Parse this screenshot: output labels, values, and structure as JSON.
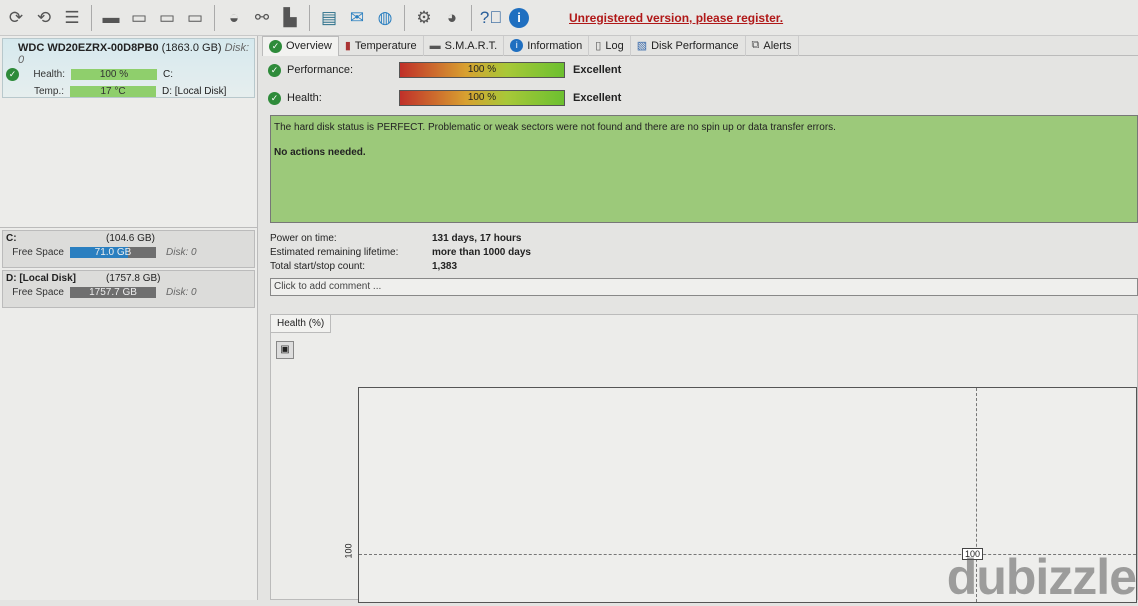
{
  "toolbar": {
    "icons": [
      "refresh-icon",
      "refresh-disk-icon",
      "list-icon",
      "disk-icon",
      "disk-clock-icon",
      "disk-check-icon",
      "disk-search-icon",
      "disk-drive-icon",
      "network-icon",
      "usb-icon",
      "report-icon",
      "mail-icon",
      "network-globe-icon",
      "gear-icon",
      "sound-icon",
      "help-icon",
      "info-icon"
    ],
    "register_text": "Unregistered version, please register."
  },
  "disk": {
    "name": "WDC WD20EZRX-00D8PB0",
    "size": "(1863.0 GB)",
    "disk": "Disk: 0",
    "health_label": "Health:",
    "health_value": "100 %",
    "temp_label": "Temp.:",
    "temp_value": "17 °C",
    "vol1": "C:",
    "vol2": "D: [Local Disk]"
  },
  "partitions": [
    {
      "name": "C:",
      "size": "(104.6 GB)",
      "free_label": "Free Space",
      "free": "71.0 GB",
      "free_fraction": 0.68,
      "disk": "Disk: 0"
    },
    {
      "name": "D: [Local Disk]",
      "size": "(1757.8 GB)",
      "free_label": "Free Space",
      "free": "1757.7 GB",
      "free_fraction": 1.0,
      "disk": "Disk: 0"
    }
  ],
  "tabs": [
    "Overview",
    "Temperature",
    "S.M.A.R.T.",
    "Information",
    "Log",
    "Disk Performance",
    "Alerts"
  ],
  "performance": {
    "label": "Performance:",
    "value": "100 %",
    "rating": "Excellent"
  },
  "health": {
    "label": "Health:",
    "value": "100 %",
    "rating": "Excellent"
  },
  "status": {
    "text": "The hard disk status is PERFECT. Problematic or weak sectors were not found and there are no spin up or data transfer errors.",
    "action": "No actions needed.",
    "color": "#9cc97a"
  },
  "info": [
    {
      "k": "Power on time:",
      "v": "131 days, 17 hours"
    },
    {
      "k": "Estimated remaining lifetime:",
      "v": "more than 1000 days"
    },
    {
      "k": "Total start/stop count:",
      "v": "1,383"
    }
  ],
  "comment_placeholder": "Click to add comment ...",
  "chart": {
    "tab": "Health (%)",
    "y_tick": "100",
    "tooltip": "100"
  },
  "watermark": "dubizzle"
}
